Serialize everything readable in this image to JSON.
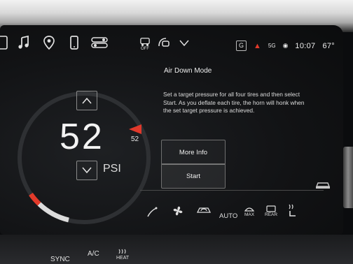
{
  "status": {
    "clock": "10:07",
    "temperature": "67°",
    "badge": "G",
    "signal": "5G"
  },
  "apps": [
    "phone-icon",
    "music-icon",
    "navigation-icon",
    "smartphone-icon",
    "controls-icon",
    "off-road-icon",
    "driver-assist-icon",
    "more-chevron-icon"
  ],
  "app_labels": {
    "off_road": "OFF"
  },
  "gauge": {
    "current_value": "52",
    "unit": "PSI",
    "target_value": "52",
    "up_label": "^",
    "down_label": "v"
  },
  "info": {
    "title": "Air Down Mode",
    "description": "Set a target pressure for all four tires and then select Start. As you deflate each tire, the horn will honk when the set target pressure is achieved.",
    "more_info_label": "More Info",
    "start_label": "Start"
  },
  "climate": {
    "auto_label": "AUTO",
    "max_label": "MAX",
    "rear_label": "REAR"
  },
  "bottom": {
    "sync_label": "SYNC",
    "ac_label": "A/C",
    "heat_label": "HEAT"
  },
  "colors": {
    "alert": "#e23a2a",
    "target_marker": "#e0392b",
    "gauge_fill": "#d9d9d9"
  }
}
